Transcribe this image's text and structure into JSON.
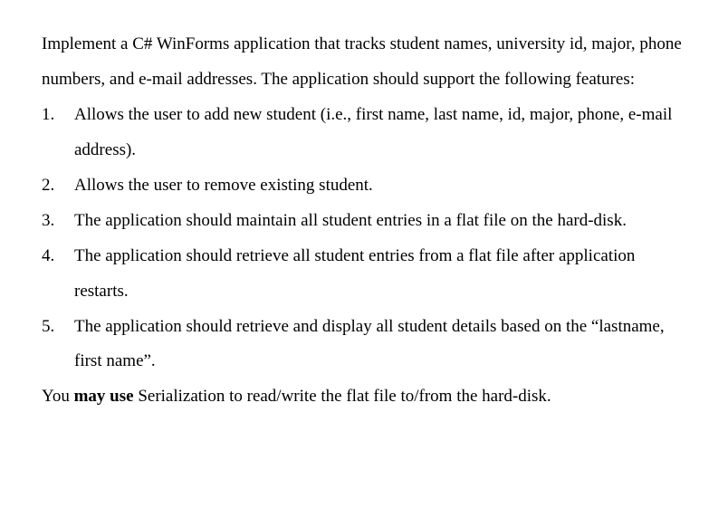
{
  "intro": "Implement a C# WinForms application that tracks student names, university id, major, phone numbers, and e-mail addresses. The application should support the following features:",
  "items": [
    "Allows the user to add new student (i.e., first name, last name, id, major, phone, e-mail address).",
    "Allows the user to remove existing student.",
    "The application should maintain all student entries in a flat file on the hard-disk.",
    "The application should retrieve all student entries from a flat file after application restarts.",
    "The application should retrieve and display all student details based on the “lastname, first name”."
  ],
  "closing_prefix": "You ",
  "closing_bold": "may use",
  "closing_suffix": " Serialization to read/write the flat file to/from the hard-disk."
}
